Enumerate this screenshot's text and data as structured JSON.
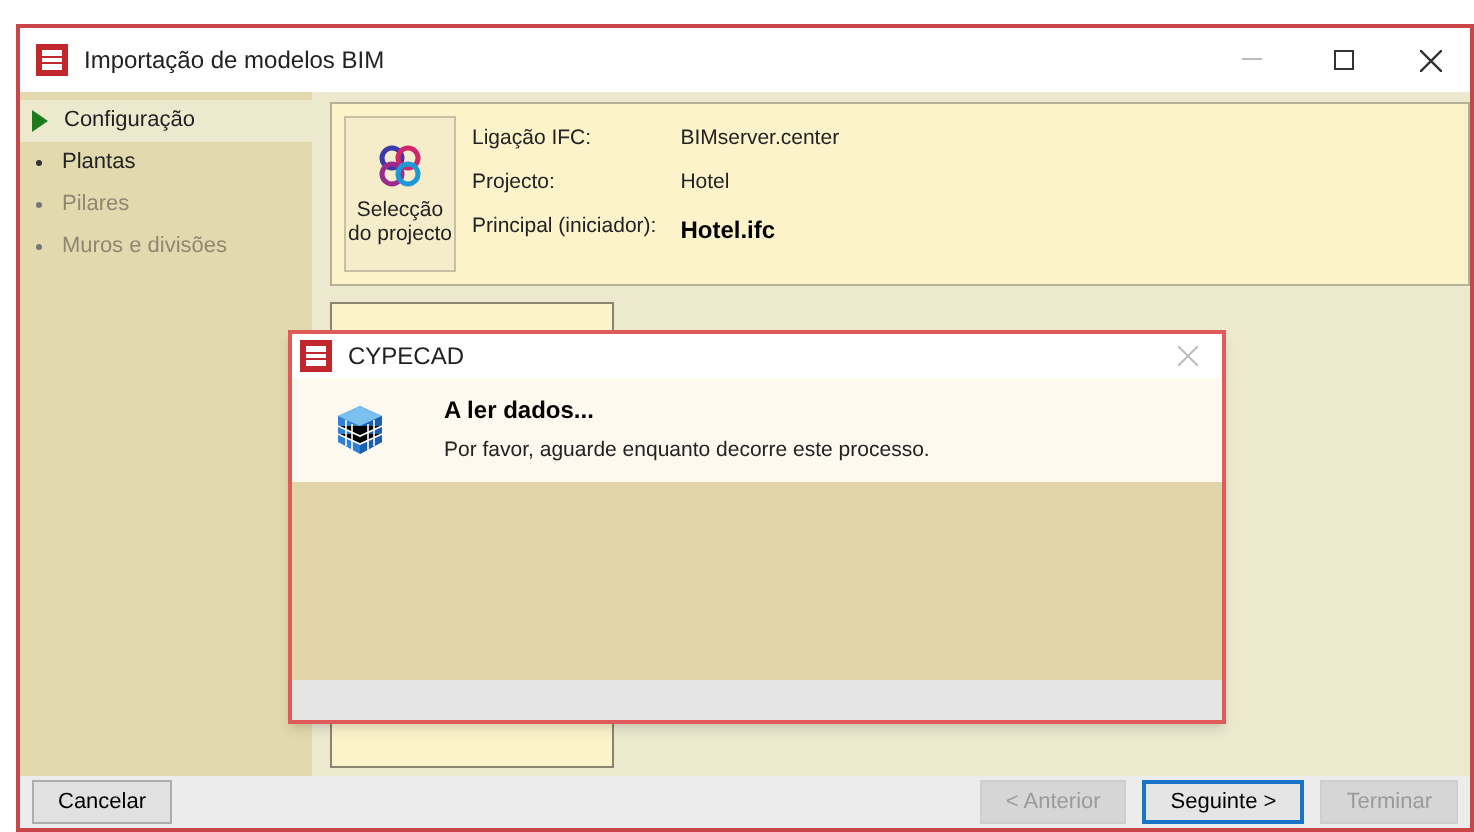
{
  "window": {
    "title": "Importação de modelos BIM"
  },
  "sidebar": {
    "items": [
      {
        "label": "Configuração",
        "selected": true,
        "disabled": false
      },
      {
        "label": "Plantas",
        "selected": false,
        "disabled": false
      },
      {
        "label": "Pilares",
        "selected": false,
        "disabled": true
      },
      {
        "label": "Muros e divisões",
        "selected": false,
        "disabled": true
      }
    ]
  },
  "project": {
    "button_label": "Selecção do projecto",
    "fields": [
      {
        "label": "Ligação IFC:",
        "value": "BIMserver.center",
        "bold": false
      },
      {
        "label": "Projecto:",
        "value": "Hotel",
        "bold": false
      },
      {
        "label": "Principal (iniciador):",
        "value": "Hotel.ifc",
        "bold": true
      }
    ]
  },
  "dialog": {
    "title": "CYPECAD",
    "heading": "A ler dados...",
    "message": "Por favor, aguarde enquanto decorre este processo."
  },
  "buttons": [
    {
      "label": "Cancelar",
      "disabled": false,
      "default": false
    },
    {
      "label": "< Anterior",
      "disabled": true,
      "default": false
    },
    {
      "label": "Seguinte >",
      "disabled": false,
      "default": true
    },
    {
      "label": "Terminar",
      "disabled": true,
      "default": false
    }
  ]
}
